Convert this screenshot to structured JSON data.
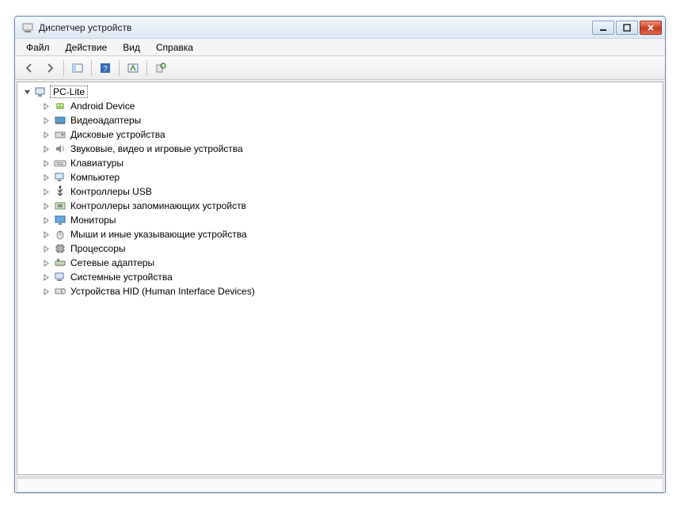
{
  "window": {
    "title": "Диспетчер устройств"
  },
  "menu": {
    "file": "Файл",
    "action": "Действие",
    "view": "Вид",
    "help": "Справка"
  },
  "tree": {
    "root": "PC-Lite",
    "items": [
      "Android Device",
      "Видеоадаптеры",
      "Дисковые устройства",
      "Звуковые, видео и игровые устройства",
      "Клавиатуры",
      "Компьютер",
      "Контроллеры USB",
      "Контроллеры запоминающих устройств",
      "Мониторы",
      "Мыши и иные указывающие устройства",
      "Процессоры",
      "Сетевые адаптеры",
      "Системные устройства",
      "Устройства HID (Human Interface Devices)"
    ]
  },
  "icons": {
    "app": "device-manager-icon",
    "categories": [
      "android-icon",
      "display-adapter-icon",
      "disk-icon",
      "sound-icon",
      "keyboard-icon",
      "computer-icon",
      "usb-icon",
      "storage-controller-icon",
      "monitor-icon",
      "mouse-icon",
      "processor-icon",
      "network-icon",
      "system-icon",
      "hid-icon"
    ]
  }
}
